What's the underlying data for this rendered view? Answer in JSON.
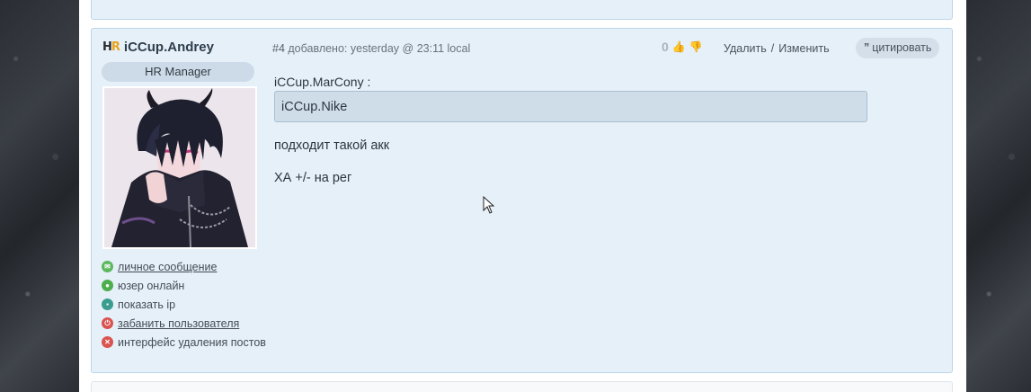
{
  "post": {
    "author": {
      "logo_h": "H",
      "logo_r": "R",
      "name": "iCCup.Andrey",
      "role": "HR Manager"
    },
    "meta": {
      "number": "#4",
      "added_text": "добавлено: yesterday @ 23:11 local"
    },
    "rating": {
      "score": "0",
      "like_icon": "thumbs-up-icon",
      "dislike_icon": "thumbs-down-icon"
    },
    "actions": {
      "delete_label": "Удалить",
      "separator": "/",
      "edit_label": "Изменить"
    },
    "quote_button": {
      "icon": "”",
      "label": "цитировать"
    },
    "user_links": [
      {
        "label": "личное сообщение",
        "icon": "mail-icon",
        "color": "#5cb85c",
        "underlined": true
      },
      {
        "label": "юзер онлайн",
        "icon": "online-icon",
        "color": "#4cae4c",
        "underlined": false
      },
      {
        "label": "показать ip",
        "icon": "ip-icon",
        "color": "#3a9d8f",
        "underlined": false
      },
      {
        "label": "забанить пользователя",
        "icon": "power-icon",
        "color": "#d9534f",
        "underlined": true
      },
      {
        "label": "интерфейс удаления постов",
        "icon": "close-circle-icon",
        "color": "#d9534f",
        "underlined": false
      }
    ],
    "body": {
      "quote_author": "iCCup.MarCony :",
      "quote_text": "iCCup.Nike",
      "lines": [
        "подходит такой акк",
        "ХА +/- на рег"
      ]
    }
  },
  "colors": {
    "post_bg": "#e6f0f9",
    "post_border": "#bcd6ea",
    "accent_logo": "#e8a317"
  }
}
